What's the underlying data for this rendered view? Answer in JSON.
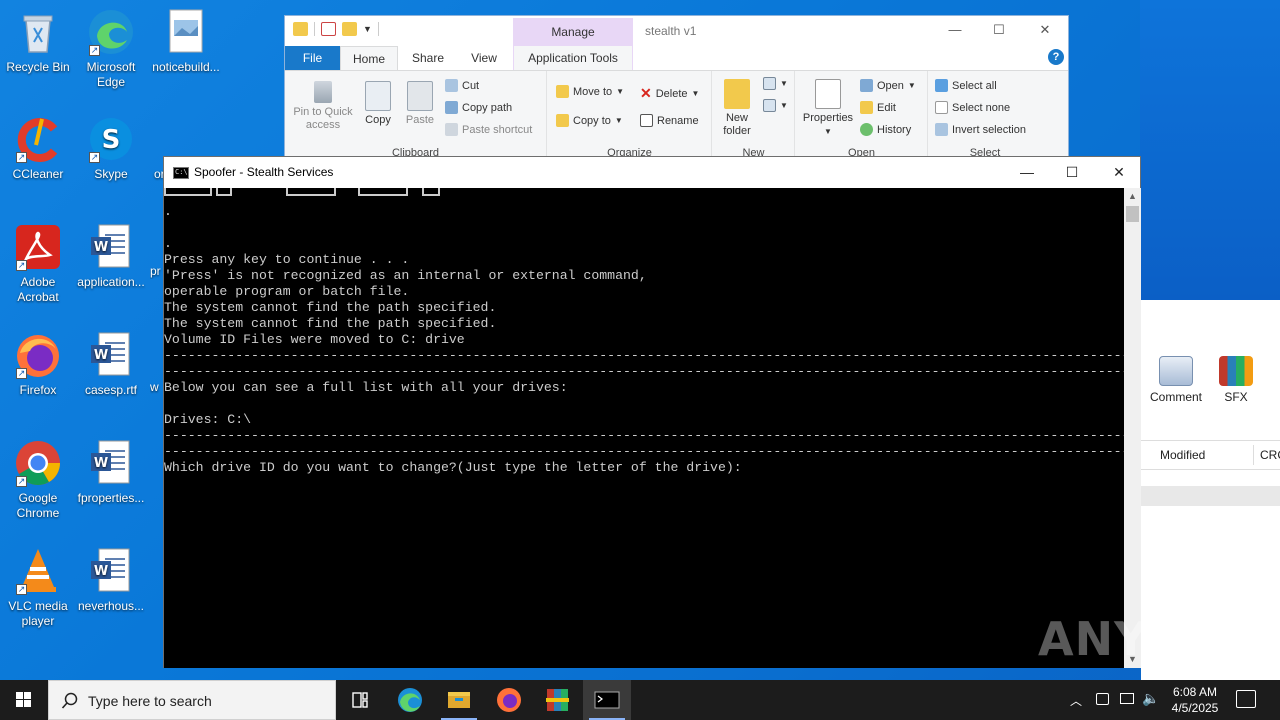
{
  "desktop": {
    "icons": [
      {
        "label": "Recycle Bin",
        "icon": "recycle-bin-icon"
      },
      {
        "label": "Microsoft Edge",
        "icon": "edge-icon"
      },
      {
        "label": "noticebuild...",
        "icon": "image-file-icon"
      },
      {
        "label": "CCleaner",
        "icon": "ccleaner-icon"
      },
      {
        "label": "Skype",
        "icon": "skype-icon"
      },
      {
        "label": "Adobe Acrobat",
        "icon": "acrobat-icon"
      },
      {
        "label": "application...",
        "icon": "word-doc-icon"
      },
      {
        "label": "Firefox",
        "icon": "firefox-icon"
      },
      {
        "label": "casesp.rtf",
        "icon": "word-doc-icon"
      },
      {
        "label": "Google Chrome",
        "icon": "chrome-icon"
      },
      {
        "label": "fproperties...",
        "icon": "word-doc-icon"
      },
      {
        "label": "VLC media player",
        "icon": "vlc-icon"
      },
      {
        "label": "neverhous...",
        "icon": "word-doc-icon"
      }
    ],
    "partial_labels": {
      "or": "or",
      "pr": "pr",
      "w": "w"
    }
  },
  "explorer": {
    "title": "stealth v1",
    "manage_label": "Manage",
    "tabs": {
      "file": "File",
      "home": "Home",
      "share": "Share",
      "view": "View",
      "app_tools": "Application Tools"
    },
    "help": "?",
    "clipboard": {
      "group_label": "Clipboard",
      "pin": "Pin to Quick access",
      "copy": "Copy",
      "paste": "Paste",
      "cut": "Cut",
      "copy_path": "Copy path",
      "paste_shortcut": "Paste shortcut"
    },
    "organize": {
      "group_label": "Organize",
      "move_to": "Move to",
      "copy_to": "Copy to",
      "delete": "Delete",
      "rename": "Rename"
    },
    "new": {
      "group_label": "New",
      "new_folder": "New folder"
    },
    "open": {
      "group_label": "Open",
      "properties": "Properties",
      "open": "Open",
      "edit": "Edit",
      "history": "History"
    },
    "select": {
      "group_label": "Select",
      "select_all": "Select all",
      "select_none": "Select none",
      "invert": "Invert selection"
    }
  },
  "rar": {
    "comment": "Comment",
    "sfx": "SFX",
    "col_modified": "Modified",
    "col_crc": "CRC"
  },
  "console": {
    "title": "Spoofer - Stealth Services",
    "lines": [
      ".",
      "",
      ".",
      "Press any key to continue . . .",
      "'Press' is not recognized as an internal or external command,",
      "operable program or batch file.",
      "The system cannot find the path specified.",
      "The system cannot find the path specified.",
      "Volume ID Files were moved to C: drive",
      "------------------------------------------------------------------------------------------------------------------------------",
      "------------------------------------------------------------------------------------------------------------------------------",
      "Below you can see a full list with all your drives:",
      "",
      "Drives: C:\\",
      "------------------------------------------------------------------------------------------------------------------------------",
      "------------------------------------------------------------------------------------------------------------------------------",
      "Which drive ID do you want to change?(Just type the letter of the drive):"
    ]
  },
  "watermark": "ANY RUN",
  "taskbar": {
    "search_placeholder": "Type here to search",
    "apps": [
      "task-view",
      "edge",
      "file-explorer",
      "firefox",
      "winrar",
      "console"
    ],
    "time": "6:08 AM",
    "date": "4/5/2025"
  }
}
